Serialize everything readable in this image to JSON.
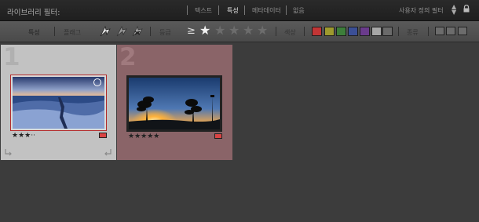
{
  "filter_bar": {
    "title": "라이브러리 필터:",
    "tabs": [
      {
        "label": "텍스트",
        "active": false
      },
      {
        "label": "특성",
        "active": true
      },
      {
        "label": "메타데이터",
        "active": false
      },
      {
        "label": "없음",
        "active": false
      }
    ],
    "preset": "사용자 정의 필터",
    "icons": [
      "updown-icon",
      "lock-icon"
    ]
  },
  "attribute_bar": {
    "attribute_label": "특성",
    "flag_label": "플래그",
    "rating_label": "등급",
    "rating_operator": "≥",
    "rating_stars": 1,
    "rating_stars_total": 5,
    "color_label": "색상",
    "colors": [
      "#c23535",
      "#9e9a2e",
      "#3d7e3a",
      "#3b4f96",
      "#6a3b8c",
      "#a7a7a7",
      "#6a6a6a"
    ],
    "kind_label": "종류"
  },
  "grid": {
    "cells": [
      {
        "number": "1",
        "rating": 3,
        "rating_text": "★★★··",
        "label_color": "#d94444",
        "selected": true,
        "image": "sea-ice-sunset",
        "badge": "circle-icon"
      },
      {
        "number": "2",
        "rating": 5,
        "rating_text": "★★★★★",
        "label_color": "#d94444",
        "selected": false,
        "image": "sunset-pine-trees"
      }
    ]
  }
}
